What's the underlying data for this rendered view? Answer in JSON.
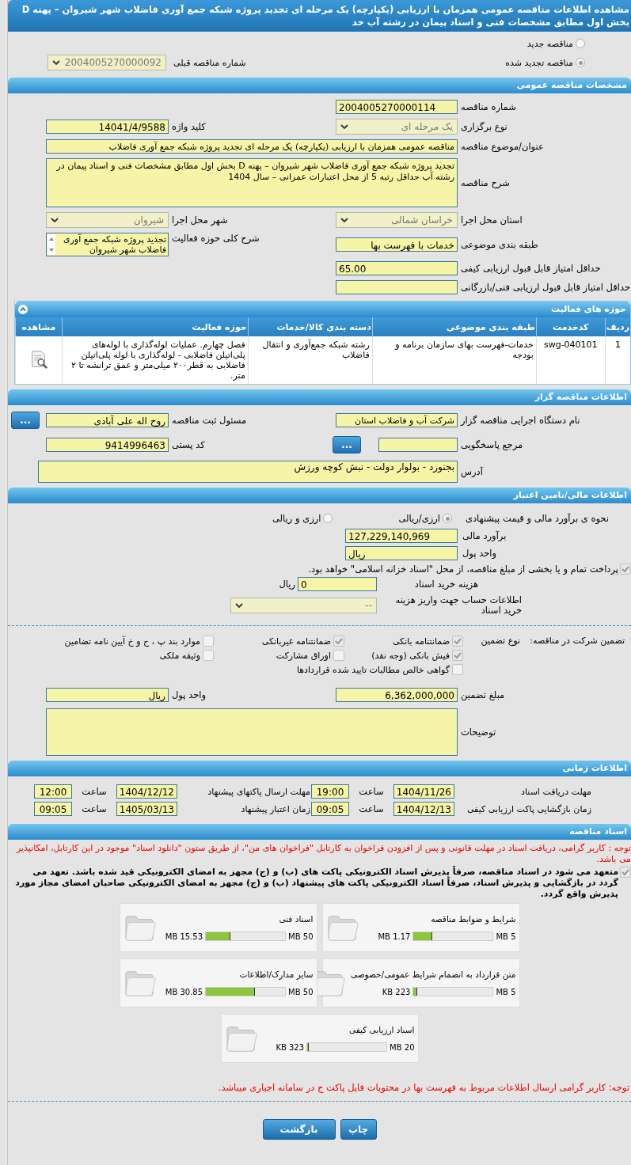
{
  "title": "مشاهده اطلاعات مناقصه عمومی همزمان با ارزیابی (یکپارچه) یک مرحله ای تجدید پروژه شبکه جمع آوری فاضلاب شهر شیروان – پهنه D بخش اول مطابق مشخصات فنی و اسناد پیمان در رشته آب حد",
  "tender_kind": [
    {
      "label": "مناقصه جدید",
      "selected": false
    },
    {
      "label": "مناقصه تجدید شده",
      "selected": true
    }
  ],
  "previous_tender": {
    "label": "شماره مناقصه قبلی",
    "value": "2004005270000092"
  },
  "general": {
    "header": "مشخصات مناقصه عمومی",
    "tender_number": {
      "label": "شماره مناقصه",
      "value": "2004005270000114"
    },
    "holding_type": {
      "label": "نوع برگزاری",
      "value": "یک مرحله ای"
    },
    "keyword": {
      "label": "کلید واژه",
      "value": "14041/4/9588"
    },
    "subject": {
      "label": "عنوان/موضوع مناقصه",
      "value": "مناقصه عمومی همزمان با ارزیابی (یکپارچه) یک مرحله ای تجدید پروژه شبکه جمع آوری فاضلاب"
    },
    "description": {
      "label": "شرح مناقصه",
      "value": "تجدید پروژه شبکه جمع آوری فاضلاب شهر شیروان – پهنه D بخش اول مطابق  مشخصات فنی و اسناد پیمان در رشته آب  حداقل رتبه 5 از محل اعتبارات عمرانی –  سال 1404"
    },
    "province": {
      "label": "استان محل اجرا",
      "value": "خراسان شمالی"
    },
    "city": {
      "label": "شهر محل اجرا",
      "value": "شیروان"
    },
    "category": {
      "label": "طبقه بندی موضوعی",
      "value": "خدمات با فهرست بها"
    },
    "activity_scope": {
      "label": "شرح کلی حوزه فعالیت",
      "value": "تجدید پروژه شبکه جمع آوری فاضلاب شهر شیروان"
    },
    "min_quality_score": {
      "label": "حداقل امتیاز قابل قبول ارزیابی کیفی",
      "value": "65.00"
    },
    "min_technical_score": {
      "label": "حداقل امتیاز قابل قبول ارزیابی فنی/بازرگانی"
    }
  },
  "activities": {
    "header": "حوزه های فعالیت",
    "columns": [
      "ردیف",
      "کدخدمت",
      "طبقه بندی موضوعی",
      "دسته بندی کالا/خدمات",
      "حوزه فعالیت",
      "مشاهده"
    ],
    "rows": [
      {
        "cells": [
          "1",
          "swg-040101",
          "خدمات-فهرست بهای سازمان برنامه و بودجه",
          "رشته شبکه جمع‌آوری و انتقال فاضلاب",
          "فصل چهارم. عملیات لوله‌گذاری با لوله‌های پلی‌اتیلن فاضلابی - لوله‌گذاری با لوله پلی‌اتیلن فاضلابی به قطر۲۰۰ میلی‌متر و عمق ترانشه تا ۲ متر."
        ]
      }
    ]
  },
  "organizer": {
    "header": "اطلاعات مناقصه گزار",
    "organization": {
      "label": "نام دستگاه اجرایی مناقصه گزار",
      "value": "شرکت آب و فاضلاب استان"
    },
    "registrar": {
      "label": "مسئول ثبت مناقصه",
      "value": "روح اله  علی آبادی",
      "button": "..."
    },
    "responder": {
      "label": "مرجع پاسخگویی",
      "button": "..."
    },
    "postal_code": {
      "label": "کد پستی",
      "value": "9414996463"
    },
    "address": {
      "label": "آدرس",
      "value": "بجنورد - بولوار دولت -  نبش کوچه ورزش"
    }
  },
  "financial": {
    "header": "اطلاعات مالی/تامین اعتبار",
    "estimate_method": {
      "label": "نحوه ی برآورد مالی و قیمت پیشنهادی",
      "options": [
        {
          "label": "ارزی/ریالی",
          "selected": true
        },
        {
          "label": "ارزی و ریالی",
          "selected": false
        }
      ]
    },
    "estimate": {
      "label": "برآورد مالی",
      "value": "127,229,140,969"
    },
    "currency": {
      "label": "واحد پول",
      "value": "ریال"
    },
    "treasury": {
      "label": "پرداخت تمام و یا بخشی از مبلغ مناقصه، از محل \"اسناد خزانه اسلامی\" خواهد بود.",
      "checked": true
    },
    "document_fee": {
      "label": "هزینه خرید اسناد",
      "value": "0",
      "unit": "ریال"
    },
    "fee_account": {
      "label": "اطلاعات حساب جهت واریز هزینه خرید اسناد",
      "value": "--"
    }
  },
  "guarantee": {
    "label": "تضمین شرکت در مناقصه:",
    "type_label": "نوع تضمین",
    "options": [
      {
        "label": "ضمانتنامه بانکی",
        "checked": true
      },
      {
        "label": "ضمانتنامه غیربانکی",
        "checked": true
      },
      {
        "label": "موارد بند پ ، ح و خ آیین نامه تضامین",
        "checked": false
      },
      {
        "label": "فیش بانکی (وجه نقد)",
        "checked": true
      },
      {
        "label": "اوراق مشارکت",
        "checked": false
      },
      {
        "label": "وثیقه ملکی",
        "checked": false
      },
      {
        "label": "گواهی خالص مطالبات تایید شده قراردادها",
        "checked": false
      }
    ],
    "amount": {
      "label": "مبلغ تضمین",
      "value": "6,362,000,000"
    },
    "currency": {
      "label": "واحد پول",
      "value": "ریال"
    },
    "notes": {
      "label": "توضیحات"
    }
  },
  "timing": {
    "header": "اطلاعات زمانی",
    "items": [
      {
        "label": "مهلت دریافت اسناد",
        "date": "1404/11/26",
        "time_label": "ساعت",
        "time": "19:00"
      },
      {
        "label": "مهلت ارسال پاکتهای پیشنهاد",
        "date": "1404/12/12",
        "time_label": "ساعت",
        "time": "12:00"
      },
      {
        "label": "زمان بازگشایی پاکت ارزیابی کیفی",
        "date": "1404/12/13",
        "time_label": "ساعت",
        "time": "09:05"
      },
      {
        "label": "زمان اعتبار پیشنهاد",
        "date": "1405/03/13",
        "time_label": "ساعت",
        "time": "09:05"
      }
    ]
  },
  "documents": {
    "header": "اسناد مناقصه",
    "notice": "توجه : کاربر گرامی، دریافت اسناد در مهلت قانونی و پس از افزودن فراخوان به کارتابل \"فراخوان های من\"، از طریق ستون \"دانلود اسناد\" موجود در این کارتابل، امکانپذیر می باشد.",
    "commitment": {
      "text": "متعهد می شود در اسناد مناقصه، صرفاً پذیرش اسناد الکترونیکی پاکت های (ب) و (ج) مجهز به امضای الکترونیکی قید شده باشد. تعهد می گردد در بازگشایی و پذیرش اسناد، صرفاً اسناد الکترونیکی پاکت های پیشنهاد (ب) و (ج) مجهز به امضای الکترونیکی صاحبان امضای مجاز مورد پذیرش واقع گردد.",
      "checked": true
    },
    "files": [
      {
        "name": "شرایط و ضوابط مناقصه",
        "size": "1.17 MB",
        "max": "5 MB",
        "level": 0.234
      },
      {
        "name": "اسناد فنی",
        "size": "15.53 MB",
        "max": "50 MB",
        "level": 0.31
      },
      {
        "name": "متن قرارداد به انضمام شرایط عمومی/خصوصی",
        "size": "223 KB",
        "max": "5 MB",
        "level": 0.044
      },
      {
        "name": "سایر مدارک/اطلاعات",
        "size": "30.85 MB",
        "max": "50 MB",
        "level": 0.62
      },
      {
        "name": "اسناد ارزیابی کیفی",
        "size": "323 KB",
        "max": "20 MB",
        "level": 0.016
      }
    ],
    "note": "توجه: کاربر گرامی ارسال اطلاعات مربوط به فهرست بها در محتویات فایل پاکت ج در سامانه اجباری میباشد."
  },
  "buttons": [
    "چاپ",
    "بازگشت"
  ]
}
